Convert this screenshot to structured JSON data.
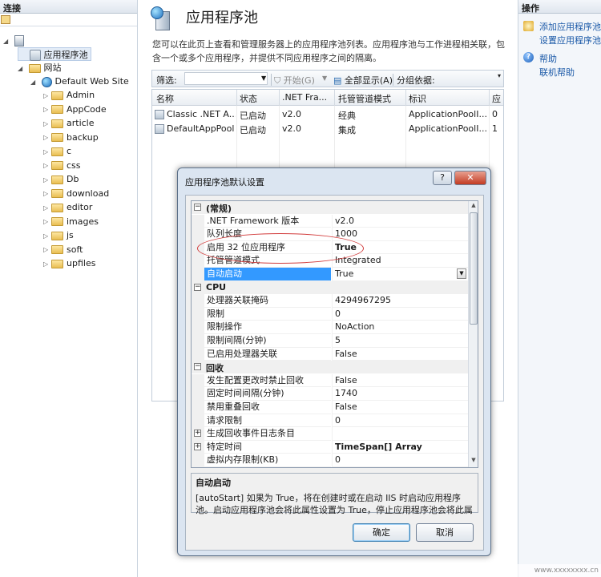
{
  "left_panel": {
    "header": "连接",
    "tree": {
      "pools_label": "应用程序池",
      "sites_label": "网站",
      "site_label": "Default Web Site",
      "folders": [
        "Admin",
        "AppCode",
        "article",
        "backup",
        "c",
        "css",
        "Db",
        "download",
        "editor",
        "images",
        "js",
        "soft",
        "upfiles"
      ]
    }
  },
  "center": {
    "title": "应用程序池",
    "description": "您可以在此页上查看和管理服务器上的应用程序池列表。应用程序池与工作进程相关联，包含一个或多个应用程序，并提供不同应用程序之间的隔离。",
    "filter": {
      "label": "筛选:",
      "start": "开始(G)",
      "show_all": "全部显示(A)",
      "group_by": "分组依据:"
    },
    "columns": [
      "名称",
      "状态",
      ".NET Fra...",
      "托管管道模式",
      "标识",
      "应"
    ],
    "rows": [
      [
        "Classic .NET A...",
        "已启动",
        "v2.0",
        "经典",
        "ApplicationPoolI...",
        "0"
      ],
      [
        "DefaultAppPool",
        "已启动",
        "v2.0",
        "集成",
        "ApplicationPoolI...",
        "1"
      ]
    ]
  },
  "right_panel": {
    "header": "操作",
    "actions": {
      "add_pool": "添加应用程序池...",
      "set_defaults": "设置应用程序池默认设置...",
      "help": "帮助",
      "online_help": "联机帮助"
    }
  },
  "dialog": {
    "title": "应用程序池默认设置",
    "help_button": "?",
    "close_button": "✕",
    "categories": {
      "general": "(常规)",
      "cpu": "CPU",
      "recycling": "回收"
    },
    "properties": {
      "general": [
        {
          "name": ".NET Framework 版本",
          "value": "v2.0"
        },
        {
          "name": "队列长度",
          "value": "1000"
        },
        {
          "name": "启用 32 位应用程序",
          "value": "True"
        },
        {
          "name": "托管管道模式",
          "value": "Integrated"
        },
        {
          "name": "自动启动",
          "value": "True"
        }
      ],
      "cpu": [
        {
          "name": "处理器关联掩码",
          "value": "4294967295"
        },
        {
          "name": "限制",
          "value": "0"
        },
        {
          "name": "限制操作",
          "value": "NoAction"
        },
        {
          "name": "限制间隔(分钟)",
          "value": "5"
        },
        {
          "name": "已启用处理器关联",
          "value": "False"
        }
      ],
      "recycling": [
        {
          "name": "发生配置更改时禁止回收",
          "value": "False"
        },
        {
          "name": "固定时间间隔(分钟)",
          "value": "1740"
        },
        {
          "name": "禁用重叠回收",
          "value": "False"
        },
        {
          "name": "请求限制",
          "value": "0"
        },
        {
          "name": "生成回收事件日志条目",
          "value": ""
        },
        {
          "name": "特定时间",
          "value": "TimeSpan[] Array"
        },
        {
          "name": "虚拟内存限制(KB)",
          "value": "0"
        }
      ]
    },
    "description": {
      "title": "自动启动",
      "text": "[autoStart] 如果为 True，将在创建时或在启动 IIS 时启动应用程序池。启动应用程序池会将此属性设置为 True，停止应用程序池会将此属性设置..."
    },
    "ok_label": "确定",
    "cancel_label": "取消"
  },
  "watermark": "www.xxxxxxxx.cn"
}
